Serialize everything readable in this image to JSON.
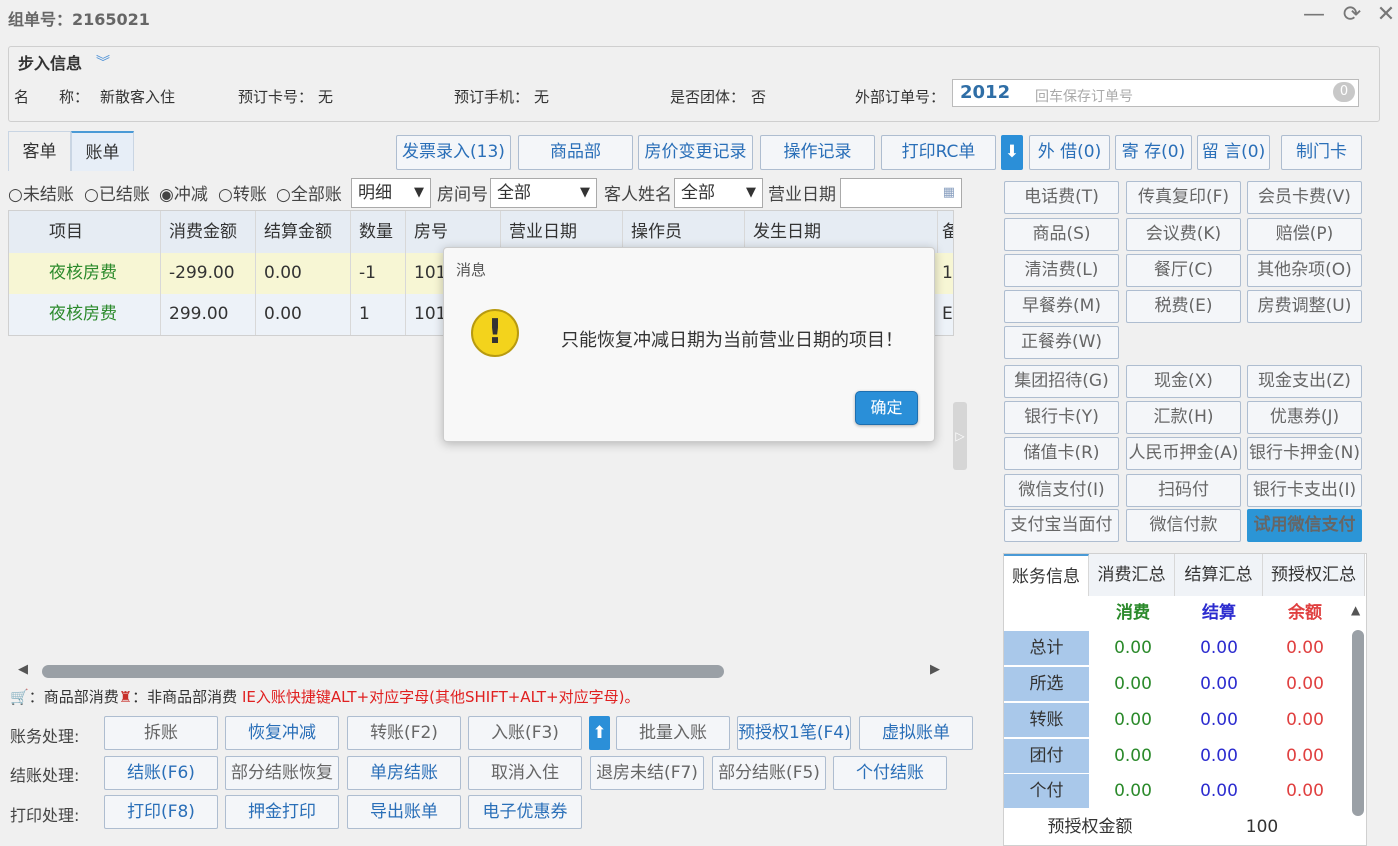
{
  "window": {
    "title": "组单号：2165021",
    "minimize": "—",
    "refresh": "⟳",
    "close": "✕"
  },
  "info": {
    "legend": "步入信息",
    "name_label": "名　　称：",
    "name_value": "新散客入住",
    "card_label": "预订卡号：",
    "card_value": "无",
    "phone_label": "预订手机：",
    "phone_value": "无",
    "group_label": "是否团体：",
    "group_value": "否",
    "ext_order_label": "外部订单号：",
    "ext_order_value": "2012",
    "ext_order_placeholder": "回车保存订单号",
    "badge": "0"
  },
  "tabs": [
    "客单",
    "账单"
  ],
  "toolbar": [
    "发票录入(13)",
    "商品部",
    "房价变更记录",
    "操作记录",
    "打印RC单",
    "外 借(0)",
    "寄 存(0)",
    "留 言(0)",
    "制门卡"
  ],
  "filters": {
    "radios": [
      "未结账",
      "已结账",
      "冲减",
      "转账",
      "全部账"
    ],
    "mode": "明细",
    "room_label": "房间号",
    "room_value": "全部",
    "guest_label": "客人姓名",
    "guest_value": "全部",
    "date_label": "营业日期"
  },
  "grid": {
    "headers": [
      "项目",
      "消费金额",
      "结算金额",
      "数量",
      "房号",
      "营业日期",
      "操作员",
      "发生日期",
      "备"
    ],
    "rows": [
      {
        "item": "夜核房费",
        "amount": "-299.00",
        "settle": "0.00",
        "qty": "-1",
        "room": "101",
        "extra": "1"
      },
      {
        "item": "夜核房费",
        "amount": "299.00",
        "settle": "0.00",
        "qty": "1",
        "room": "101",
        "extra": "E"
      }
    ]
  },
  "legend_line": {
    "a": "：商品部消费",
    "b": "：非商品部消费",
    "hint": "IE入账快捷键ALT+对应字母(其他SHIFT+ALT+对应字母)。"
  },
  "actions": {
    "account_label": "账务处理:",
    "account": [
      "拆账",
      "恢复冲减",
      "转账(F2)",
      "入账(F3)",
      "批量入账",
      "预授权1笔(F4)",
      "虚拟账单"
    ],
    "checkout_label": "结账处理:",
    "checkout": [
      "结账(F6)",
      "部分结账恢复",
      "单房结账",
      "取消入住",
      "退房未结(F7)",
      "部分结账(F5)",
      "个付结账"
    ],
    "print_label": "打印处理:",
    "print": [
      "打印(F8)",
      "押金打印",
      "导出账单",
      "电子优惠券"
    ]
  },
  "right_buttons": [
    [
      "电话费(T)",
      "传真复印(F)",
      "会员卡费(V)"
    ],
    [
      "商品(S)",
      "会议费(K)",
      "赔偿(P)"
    ],
    [
      "清洁费(L)",
      "餐厅(C)",
      "其他杂项(O)"
    ],
    [
      "早餐券(M)",
      "税费(E)",
      "房费调整(U)"
    ],
    [
      "正餐券(W)"
    ],
    [
      "集团招待(G)",
      "现金(X)",
      "现金支出(Z)"
    ],
    [
      "银行卡(Y)",
      "汇款(H)",
      "优惠券(J)"
    ],
    [
      "储值卡(R)",
      "人民币押金(A)",
      "银行卡押金(N)"
    ],
    [
      "微信支付(I)",
      "扫码付",
      "银行卡支出(I)"
    ],
    [
      "支付宝当面付",
      "微信付款",
      "试用微信支付"
    ]
  ],
  "summary": {
    "tabs": [
      "账务信息",
      "消费汇总",
      "结算汇总",
      "预授权汇总"
    ],
    "cols": [
      "消费",
      "结算",
      "余额"
    ],
    "rows": [
      {
        "label": "总计",
        "v": [
          "0.00",
          "0.00",
          "0.00"
        ]
      },
      {
        "label": "所选",
        "v": [
          "0.00",
          "0.00",
          "0.00"
        ]
      },
      {
        "label": "转账",
        "v": [
          "0.00",
          "0.00",
          "0.00"
        ]
      },
      {
        "label": "团付",
        "v": [
          "0.00",
          "0.00",
          "0.00"
        ]
      },
      {
        "label": "个付",
        "v": [
          "0.00",
          "0.00",
          "0.00"
        ]
      }
    ],
    "preauth_label": "预授权金额",
    "preauth_value": "100"
  },
  "dialog": {
    "title": "消息",
    "message": "只能恢复冲减日期为当前营业日期的项目！",
    "ok": "确定"
  }
}
